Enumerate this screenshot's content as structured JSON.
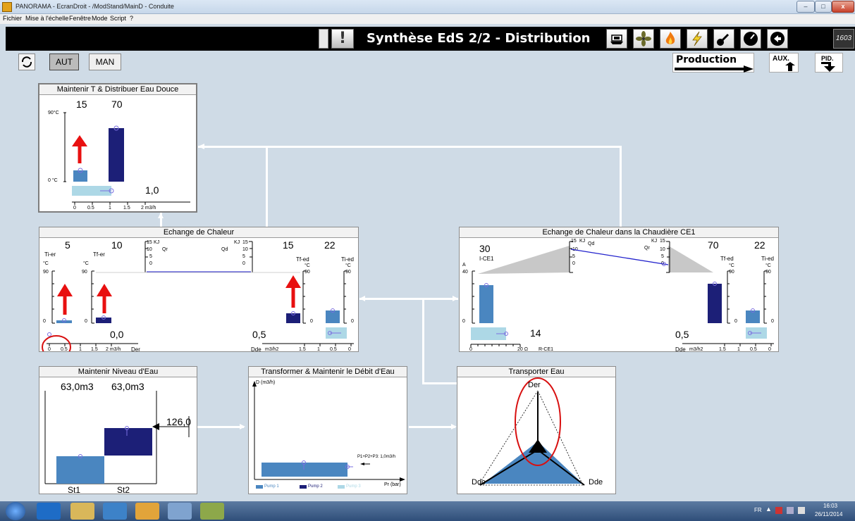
{
  "window": {
    "title": "PANORAMA - EcranDroit - /ModStand/MainD - Conduite",
    "min": "–",
    "max": "□",
    "close": "x"
  },
  "menu": [
    "Fichier",
    "Mise à l'échelle",
    "Fenêtre",
    "Mode",
    "Script",
    "?"
  ],
  "header": {
    "title": "Synthèse EdS 2/2 - Distribution",
    "clock": "1603",
    "buttons": [
      "ship-icon",
      "fan-icon",
      "fire-icon",
      "lightning-icon",
      "valve-icon",
      "gauge-icon",
      "back-icon"
    ]
  },
  "controls": {
    "aut": "AUT",
    "man": "MAN",
    "production": "Production",
    "aux": "AUX.",
    "pid": "PID."
  },
  "panel_eau_douce": {
    "title": "Maintenir T & Distribuer Eau Douce",
    "v1": "15",
    "v2": "70",
    "ymax": "90°C",
    "ymin": "0 °C",
    "flow": "1,0",
    "xticks": [
      "0",
      "0.5",
      "1",
      "1.5",
      "2 m3/h"
    ],
    "bar1_fraction": 0.16,
    "bar2_fraction": 0.78,
    "flow_fraction": 0.5
  },
  "panel_echange": {
    "title": "Echange de Chaleur",
    "ti_er": {
      "value": "5",
      "label": "Ti-er",
      "unit": "°C",
      "max": "90",
      "min": "0"
    },
    "tf_er": {
      "value": "10",
      "label": "Tf-er",
      "unit": "°C",
      "max": "90",
      "min": "0"
    },
    "qr": {
      "label": "Qr",
      "unit": "KJ",
      "ticks": [
        "15",
        "10",
        "5",
        "0"
      ]
    },
    "qd": {
      "label": "Qd",
      "unit": "KJ",
      "ticks": [
        "15",
        "10",
        "5",
        "0"
      ]
    },
    "tf_ed": {
      "value": "15",
      "label": "Tf-ed",
      "unit": "°C",
      "max": "90",
      "min": "0"
    },
    "ti_ed": {
      "value": "22",
      "label": "Ti-ed",
      "unit": "°C",
      "max": "90",
      "min": "0"
    },
    "der_value": "0,0",
    "der_label": "Der",
    "der_ticks": [
      "0",
      "0.5",
      "1",
      "1.5",
      "2 m3/h"
    ],
    "dde_value": "0,5",
    "dde_label": "Dde",
    "dde_ticks": [
      "m3/h2",
      "1.5",
      "1",
      "0.5",
      "0"
    ]
  },
  "panel_chaudiere": {
    "title": "Echange de Chaleur dans la Chaudière CE1",
    "i_value": "30",
    "i_label": "I-CE1",
    "i_unit": "A",
    "i_max": "40",
    "i_min": "0",
    "qd": {
      "label": "Qd",
      "unit": "KJ",
      "ticks": [
        "15",
        "10",
        "5",
        "0"
      ]
    },
    "qr": {
      "label": "Qr",
      "unit": "KJ",
      "ticks": [
        "15",
        "10",
        "5",
        "0"
      ]
    },
    "tf_ed": {
      "value": "70",
      "label": "Tf-ed",
      "unit": "°C",
      "max": "90",
      "min": "0"
    },
    "ti_ed": {
      "value": "22",
      "label": "Ti-ed",
      "unit": "°C",
      "max": "90",
      "min": "0"
    },
    "r_value": "14",
    "r_ticks": [
      "0",
      "20 Ω",
      "R-CE1"
    ],
    "dde_value": "0,5",
    "dde_label": "Dde",
    "dde_ticks": [
      "m3/h2",
      "1.5",
      "1",
      "0.5",
      "0"
    ]
  },
  "panel_niveau": {
    "title": "Maintenir Niveau d'Eau",
    "st1_value": "63,0m3",
    "st2_value": "63,0m3",
    "total": "126,0",
    "st1_label": "St1",
    "st2_label": "St2"
  },
  "panel_debit": {
    "title": "Transformer & Maintenir le Débit d'Eau",
    "ylabel": "D (m3/h)",
    "xlabel": "Pr (bar)",
    "annotation": "P1+P2+P3: 1,0m3/h",
    "legend": [
      "Pump 1",
      "Pump 2",
      "Pump 3"
    ]
  },
  "panel_transport": {
    "title": "Transporter Eau",
    "top": "Der",
    "left": "Ddc",
    "right": "Dde"
  },
  "colors": {
    "light_blue": "#4a86c0",
    "dark_blue": "#1c1f77",
    "pale_blue": "#add8e6",
    "red": "#e81010"
  },
  "taskbar": {
    "lang": "FR",
    "time": "16:03",
    "date": "26/11/2014"
  }
}
